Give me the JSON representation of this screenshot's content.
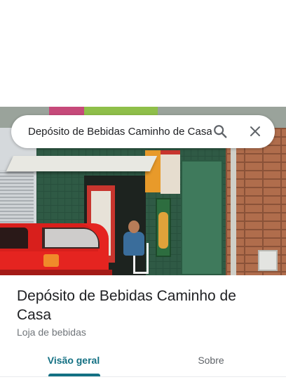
{
  "search": {
    "query": "Depósito de Bebidas Caminho de Casa",
    "search_icon": "search-icon",
    "close_icon": "close-icon"
  },
  "place": {
    "name": "Depósito de Bebidas Caminho de Casa",
    "category": "Loja de bebidas",
    "photo": "street-view-photo"
  },
  "tabs": [
    {
      "label": "Visão geral",
      "selected": true
    },
    {
      "label": "Sobre",
      "selected": false
    }
  ],
  "colors": {
    "accent": "#137083",
    "title_text": "#202124",
    "secondary_text": "#70757a",
    "inactive_tab": "#5f6368"
  }
}
